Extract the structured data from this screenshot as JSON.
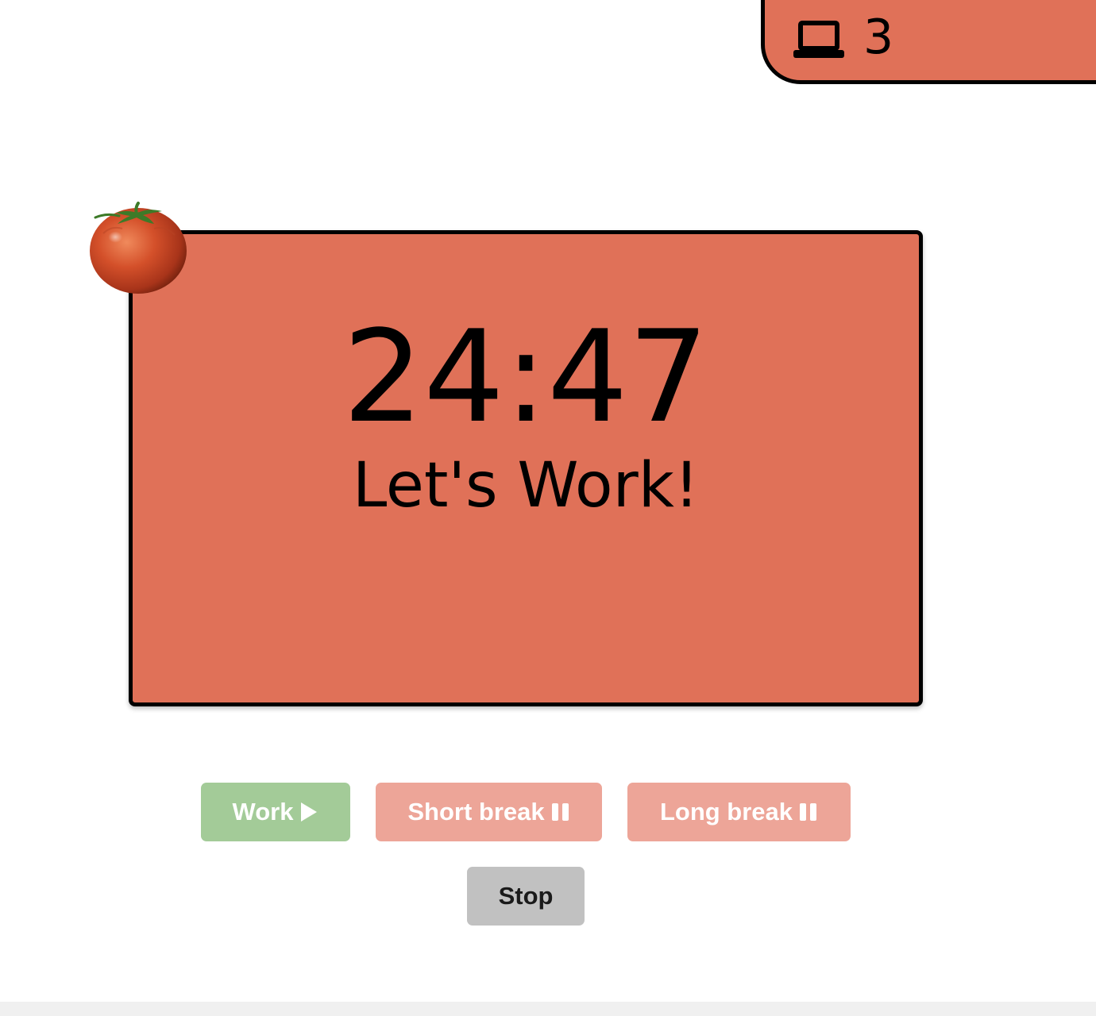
{
  "session": {
    "icon": "laptop-icon",
    "count": "3"
  },
  "timer": {
    "time": "24:47",
    "status": "Let's Work!",
    "accent_color": "#e07158"
  },
  "controls": {
    "work_label": "Work",
    "work_icon": "play-icon",
    "short_break_label": "Short break",
    "short_break_icon": "pause-icon",
    "long_break_label": "Long break",
    "long_break_icon": "pause-icon",
    "stop_label": "Stop"
  },
  "colors": {
    "work": "#a3cb98",
    "break": "#eda598",
    "stop": "#c1c1c1"
  }
}
